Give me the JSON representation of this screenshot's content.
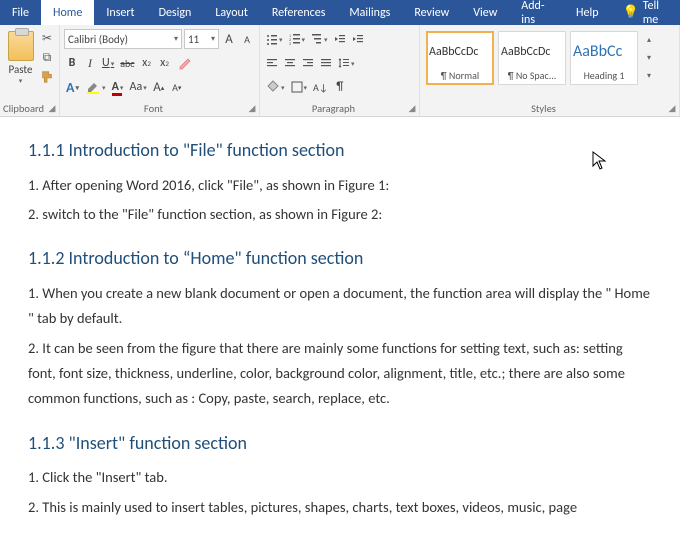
{
  "tabs": {
    "file": "File",
    "home": "Home",
    "insert": "Insert",
    "design": "Design",
    "layout": "Layout",
    "references": "References",
    "mailings": "Mailings",
    "review": "Review",
    "view": "View",
    "addins": "Add-ins",
    "help": "Help",
    "tellme": "Tell me"
  },
  "clipboard": {
    "paste": "Paste",
    "label": "Clipboard"
  },
  "font": {
    "name": "Calibri (Body)",
    "size": "11",
    "label": "Font",
    "bold": "B",
    "italic": "I",
    "underline": "U",
    "strike": "abc",
    "sub": "x",
    "sup": "x",
    "grow": "A",
    "shrink": "A",
    "caseAa": "Aa"
  },
  "paragraph": {
    "label": "Paragraph",
    "pilcrow": "¶"
  },
  "styles": {
    "label": "Styles",
    "preview": "AaBbCcDc",
    "preview_heading": "AaBbCc",
    "items": [
      {
        "name": "¶ Normal"
      },
      {
        "name": "¶ No Spac..."
      },
      {
        "name": "Heading 1"
      }
    ]
  },
  "doc": {
    "h1": "1.1.1 Introduction to \"File\" function section",
    "p1": "1. After opening Word 2016, click \"File\", as shown in Figure 1:",
    "p2": "2. switch to the \"File\" function section, as shown in Figure 2:",
    "h2": "1.1.2 Introduction to “Home\" function section",
    "p3": "1. When you create a new blank document or open a document, the function area will display the \" Home \" tab by default.",
    "p4": "2. It can be seen from the figure that there are mainly some functions for setting text, such as: setting font, font size, thickness, underline, color, background color, alignment, title, etc.; there are also some common functions, such as : Copy, paste, search, replace, etc.",
    "h3": "1.1.3 \"Insert\" function section",
    "p5": "1. Click the \"Insert\" tab.",
    "p6": "2. This is mainly used to insert tables, pictures, shapes, charts, text boxes, videos, music, page"
  }
}
